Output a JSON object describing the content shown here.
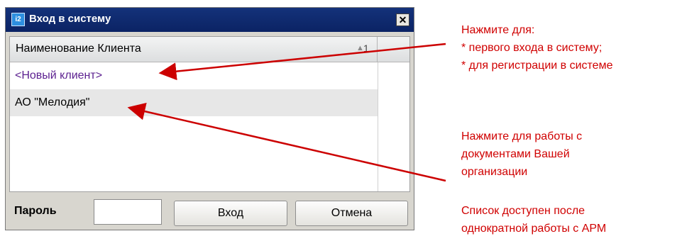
{
  "window": {
    "title": "Вход в систему",
    "app_icon_glyph": "i2",
    "close_glyph": "✕"
  },
  "list": {
    "column_header": "Наименование Клиента",
    "sort_indicator": "▲",
    "sort_number": "1",
    "rows": [
      {
        "label": "<Новый клиент>"
      },
      {
        "label": "АО \"Мелодия\""
      }
    ]
  },
  "bottom": {
    "password_label": "Пароль",
    "password_value": "",
    "login_button": "Вход",
    "cancel_button": "Отмена"
  },
  "annotations": {
    "note1": [
      "Нажмите для:",
      "* первого входа в систему;",
      "* для регистрации в системе"
    ],
    "note2": [
      "Нажмите для работы с",
      "документами Вашей",
      "организации"
    ],
    "note3": [
      "Список доступен после",
      "однократной работы с АРМ"
    ]
  },
  "colors": {
    "titlebar": "#0b2364",
    "annotation": "#d00000",
    "new_client_text": "#5b1f8f"
  }
}
